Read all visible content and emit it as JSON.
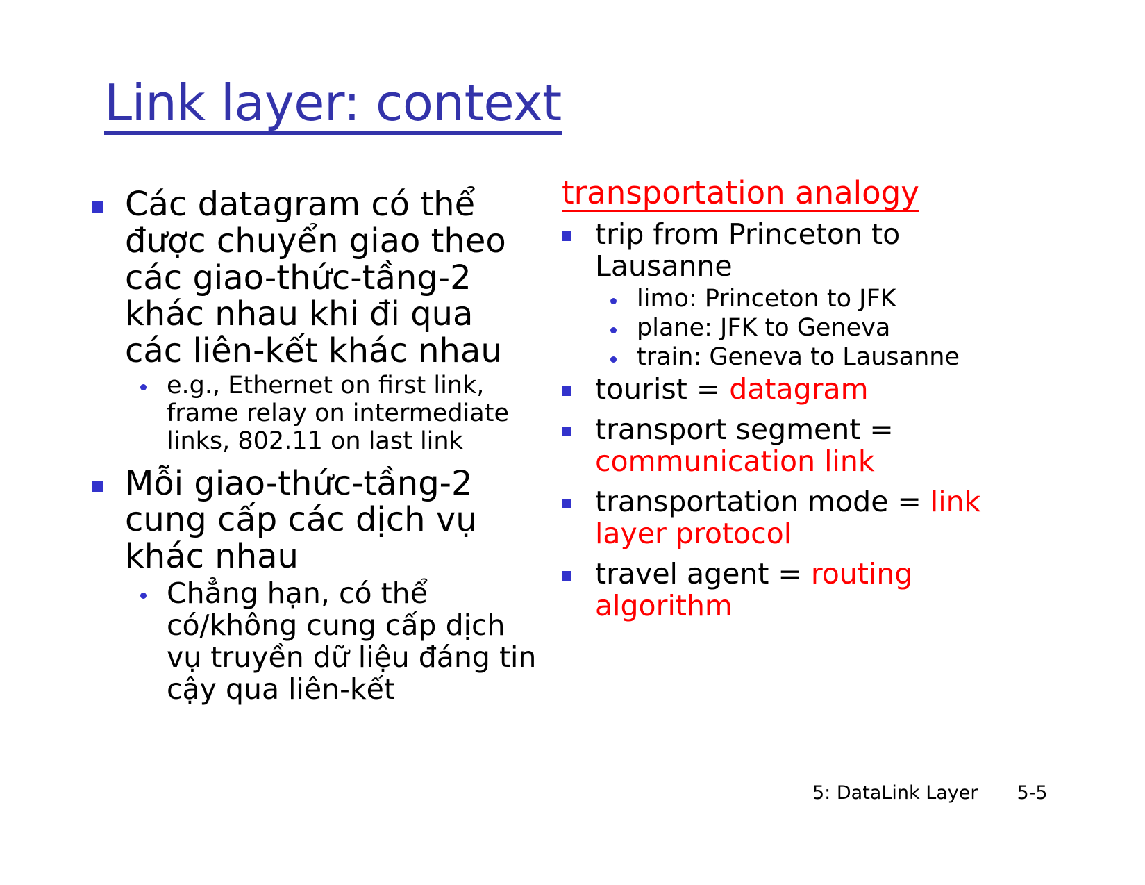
{
  "slide": {
    "title": "Link layer: context",
    "title_color": "#3333AA",
    "accent_red": "#FF0000",
    "bullet_color": "#3333CC"
  },
  "left_column": {
    "bullets": [
      {
        "text": "Các datagram có thể được chuyển giao theo các giao-thức-tầng-2 khác nhau khi đi qua các liên-kết khác nhau",
        "sub": [
          "e.g., Ethernet on first link, frame relay on intermediate links, 802.11 on last link"
        ]
      },
      {
        "text": "Mỗi giao-thức-tầng-2 cung cấp các dịch vụ khác nhau",
        "sub": [
          "Chẳng hạn, có thể có/không cung cấp dịch vụ truyền dữ liệu đáng tin cậy qua liên-kết"
        ]
      }
    ]
  },
  "right_column": {
    "heading": "transportation analogy",
    "bullets": [
      {
        "text": "trip from Princeton to Lausanne",
        "sub": [
          "limo: Princeton to JFK",
          "plane: JFK to Geneva",
          "train: Geneva to Lausanne"
        ]
      },
      {
        "black": "tourist = ",
        "red": "datagram"
      },
      {
        "black": "transport segment = ",
        "red": "communication link"
      },
      {
        "black": "transportation mode = ",
        "red": "link layer protocol"
      },
      {
        "black": "travel agent = ",
        "red": "routing algorithm"
      }
    ]
  },
  "footer": {
    "chapter": "5: DataLink Layer",
    "page": "5-5"
  }
}
